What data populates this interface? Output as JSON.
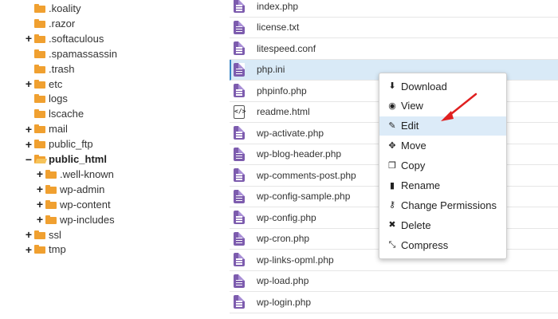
{
  "tree": [
    {
      "label": ".koality",
      "expander": "",
      "level": 1
    },
    {
      "label": ".razor",
      "expander": "",
      "level": 1
    },
    {
      "label": ".softaculous",
      "expander": "+",
      "level": 1
    },
    {
      "label": ".spamassassin",
      "expander": "",
      "level": 1
    },
    {
      "label": ".trash",
      "expander": "",
      "level": 1
    },
    {
      "label": "etc",
      "expander": "+",
      "level": 1
    },
    {
      "label": "logs",
      "expander": "",
      "level": 1
    },
    {
      "label": "lscache",
      "expander": "",
      "level": 1
    },
    {
      "label": "mail",
      "expander": "+",
      "level": 1
    },
    {
      "label": "public_ftp",
      "expander": "+",
      "level": 1
    },
    {
      "label": "public_html",
      "expander": "−",
      "level": 1,
      "bold": true,
      "open": true
    },
    {
      "label": ".well-known",
      "expander": "+",
      "level": 2
    },
    {
      "label": "wp-admin",
      "expander": "+",
      "level": 2
    },
    {
      "label": "wp-content",
      "expander": "+",
      "level": 2
    },
    {
      "label": "wp-includes",
      "expander": "+",
      "level": 2
    },
    {
      "label": "ssl",
      "expander": "+",
      "level": 1
    },
    {
      "label": "tmp",
      "expander": "+",
      "level": 1
    }
  ],
  "files": [
    {
      "name": "index.php",
      "type": "php"
    },
    {
      "name": "license.txt",
      "type": "php"
    },
    {
      "name": "litespeed.conf",
      "type": "php"
    },
    {
      "name": "php.ini",
      "type": "php",
      "selected": true
    },
    {
      "name": "phpinfo.php",
      "type": "php"
    },
    {
      "name": "readme.html",
      "type": "html"
    },
    {
      "name": "wp-activate.php",
      "type": "php"
    },
    {
      "name": "wp-blog-header.php",
      "type": "php"
    },
    {
      "name": "wp-comments-post.php",
      "type": "php"
    },
    {
      "name": "wp-config-sample.php",
      "type": "php"
    },
    {
      "name": "wp-config.php",
      "type": "php"
    },
    {
      "name": "wp-cron.php",
      "type": "php"
    },
    {
      "name": "wp-links-opml.php",
      "type": "php"
    },
    {
      "name": "wp-load.php",
      "type": "php"
    },
    {
      "name": "wp-login.php",
      "type": "php"
    }
  ],
  "menu": [
    {
      "label": "Download",
      "icon": "download-icon",
      "glyph": "⬇"
    },
    {
      "label": "View",
      "icon": "eye-icon",
      "glyph": "◉"
    },
    {
      "label": "Edit",
      "icon": "pencil-icon",
      "glyph": "✎",
      "hover": true
    },
    {
      "label": "Move",
      "icon": "move-icon",
      "glyph": "✥"
    },
    {
      "label": "Copy",
      "icon": "copy-icon",
      "glyph": "❐"
    },
    {
      "label": "Rename",
      "icon": "file-icon",
      "glyph": "▮"
    },
    {
      "label": "Change Permissions",
      "icon": "key-icon",
      "glyph": "⚷"
    },
    {
      "label": "Delete",
      "icon": "close-icon",
      "glyph": "✖"
    },
    {
      "label": "Compress",
      "icon": "compress-icon",
      "glyph": "⤡"
    }
  ],
  "colors": {
    "folder": "#f0a030",
    "php_icon": "#7d5cae",
    "selection": "#d9eaf7",
    "menu_hover": "#dcebf8",
    "arrow": "#e02020"
  }
}
